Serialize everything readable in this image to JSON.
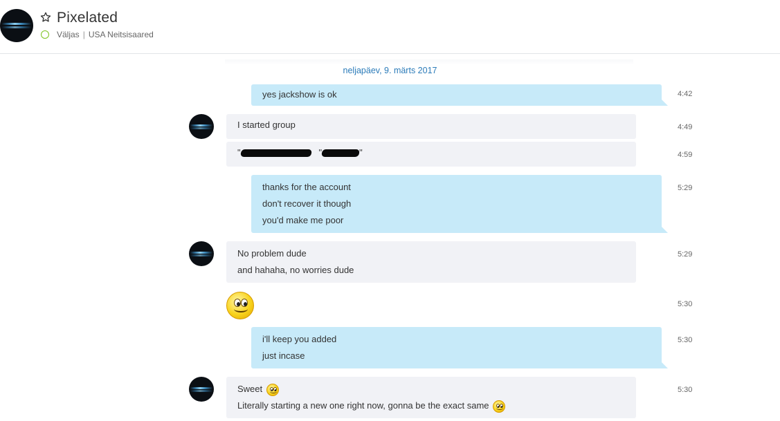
{
  "header": {
    "title": "Pixelated",
    "status": "Väljas",
    "separator": "|",
    "location": "USA Neitsisaared"
  },
  "date_divider": "neljapäev, 9. märts 2017",
  "messages": [
    {
      "direction": "out",
      "lines": [
        "yes jackshow is ok"
      ],
      "time": "4:42"
    },
    {
      "direction": "in",
      "lines": [
        "I started group"
      ],
      "time": "4:49"
    },
    {
      "direction": "in",
      "lines": [
        "\" [redacted] \" [redacted] \""
      ],
      "time": "4:59"
    },
    {
      "direction": "out",
      "lines": [
        "thanks for the account",
        "don't recover it though",
        "you'd make me poor"
      ],
      "time": "5:29"
    },
    {
      "direction": "in",
      "lines": [
        "No problem dude",
        "and hahaha, no worries dude"
      ],
      "time": "5:29"
    },
    {
      "direction": "in",
      "emoticon": "smile-emoticon",
      "time": "5:30"
    },
    {
      "direction": "out",
      "lines": [
        "i'll keep you added",
        "just incase"
      ],
      "time": "5:30"
    },
    {
      "direction": "in",
      "lines": [
        "Sweet",
        "Literally starting a new one right now, gonna be the exact same"
      ],
      "time": "5:30"
    }
  ],
  "colors": {
    "incoming_bubble": "#f1f2f6",
    "outgoing_bubble": "#c7eaf9",
    "date_text": "#2b7bb9",
    "presence_away": "#7dc31f"
  }
}
